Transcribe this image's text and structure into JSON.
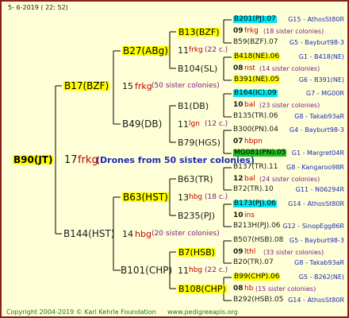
{
  "header": {
    "date": "5-  6-2019 ( 22: 52)"
  },
  "root": {
    "id": "B90(JT)",
    "num": "17",
    "code": "frkg",
    "info": "(Drones from 50 sister colonies)"
  },
  "gen1": [
    {
      "id": "B17(BZF)"
    },
    {
      "id": "B144(HST)"
    }
  ],
  "gen2": [
    {
      "id": "B27(ABg)",
      "num": "15",
      "code": "frkg",
      "sister": "(50 sister colonies)"
    },
    {
      "id": "B49(DB)"
    },
    {
      "id": "B63(HST)",
      "num": "14",
      "code": "hbg",
      "sister": "(20 sister colonies)"
    },
    {
      "id": "B101(CHP)"
    }
  ],
  "gen3": [
    {
      "id": "B13(BZF)",
      "num": "11",
      "code": "frkg",
      "sister": "(22 c.)"
    },
    {
      "id": "B104(SL)"
    },
    {
      "id": "B1(DB)",
      "num": "11",
      "code": "lgn",
      "sister": "(12 c.)"
    },
    {
      "id": "B79(HGS)"
    },
    {
      "id": "B63(TR)",
      "num": "13",
      "code": "hbg",
      "sister": "(18 c.)"
    },
    {
      "id": "B235(PJ)"
    },
    {
      "id": "B7(HSB)",
      "num": "11",
      "code": "hbg",
      "sister": "(22 c.)"
    },
    {
      "id": "B108(CHP)"
    }
  ],
  "gen4": [
    {
      "type": "id",
      "id": "B201(PJ).07",
      "hl": "c",
      "ref": "G15 - AthosSt80R"
    },
    {
      "type": "drone",
      "num": "09",
      "code": "frkg",
      "sister": "(18 sister colonies)"
    },
    {
      "type": "id",
      "id": "B59(BZF).07",
      "hl": "",
      "ref": "G5 - Bayburt98-3"
    },
    {
      "type": "id",
      "id": "B418(NE).06",
      "hl": "y",
      "ref": "G1 - B418(NE)"
    },
    {
      "type": "drone",
      "num": "08",
      "code": "nst",
      "sister": "(14 sister colonies)"
    },
    {
      "type": "id",
      "id": "B391(NE).05",
      "hl": "y",
      "ref": "G6 - B391(NE)"
    },
    {
      "type": "id",
      "id": "B164(IC).09",
      "hl": "c",
      "ref": "G7 - MG00R"
    },
    {
      "type": "drone",
      "num": "10",
      "code": "bal",
      "sister": "(23 sister colonies)"
    },
    {
      "type": "id",
      "id": "B135(TR).06",
      "hl": "",
      "ref": "G8 - Takab93aR"
    },
    {
      "type": "id",
      "id": "B300(PN).04",
      "hl": "",
      "ref": "G4 - Bayburt98-3"
    },
    {
      "type": "drone",
      "num": "07",
      "code": "hbpn",
      "sister": ""
    },
    {
      "type": "id",
      "id": "MG081(PN).05",
      "hl": "g",
      "ref": "G1 - Margret04R"
    },
    {
      "type": "id",
      "id": "B137(TR).11",
      "hl": "",
      "ref": "G8 - Kangaroo98R"
    },
    {
      "type": "drone",
      "num": "12",
      "code": "bal",
      "sister": "(24 sister colonies)"
    },
    {
      "type": "id",
      "id": "B72(TR).10",
      "hl": "",
      "ref": "G11 - N06294R"
    },
    {
      "type": "id",
      "id": "B173(PJ).06",
      "hl": "c",
      "ref": "G14 - AthosSt80R"
    },
    {
      "type": "drone",
      "num": "10",
      "code": "ins",
      "sister": ""
    },
    {
      "type": "id",
      "id": "B213H(PJ).06",
      "hl": "",
      "ref": "G12 - SinopEgg86R"
    },
    {
      "type": "id",
      "id": "B507(HSB).08",
      "hl": "",
      "ref": "G5 - Bayburt98-3"
    },
    {
      "type": "drone",
      "num": "09",
      "code": "lthl",
      "sister": "(33 sister colonies)"
    },
    {
      "type": "id",
      "id": "B20(TR).07",
      "hl": "",
      "ref": "G8 - Takab93aR"
    },
    {
      "type": "id",
      "id": "B99(CHP).06",
      "hl": "y",
      "ref": "G5 - B262(NE)"
    },
    {
      "type": "drone",
      "num": "08",
      "code": "hb",
      "sister": "(15 sister colonies)"
    },
    {
      "type": "id",
      "id": "B292(HSB).05",
      "hl": "",
      "ref": "G14 - AthosSt80R"
    }
  ],
  "footer": {
    "copyright": "Copyright 2004-2019 © Karl Kehrle Foundation",
    "site": "www.pedigreeapis.org"
  }
}
